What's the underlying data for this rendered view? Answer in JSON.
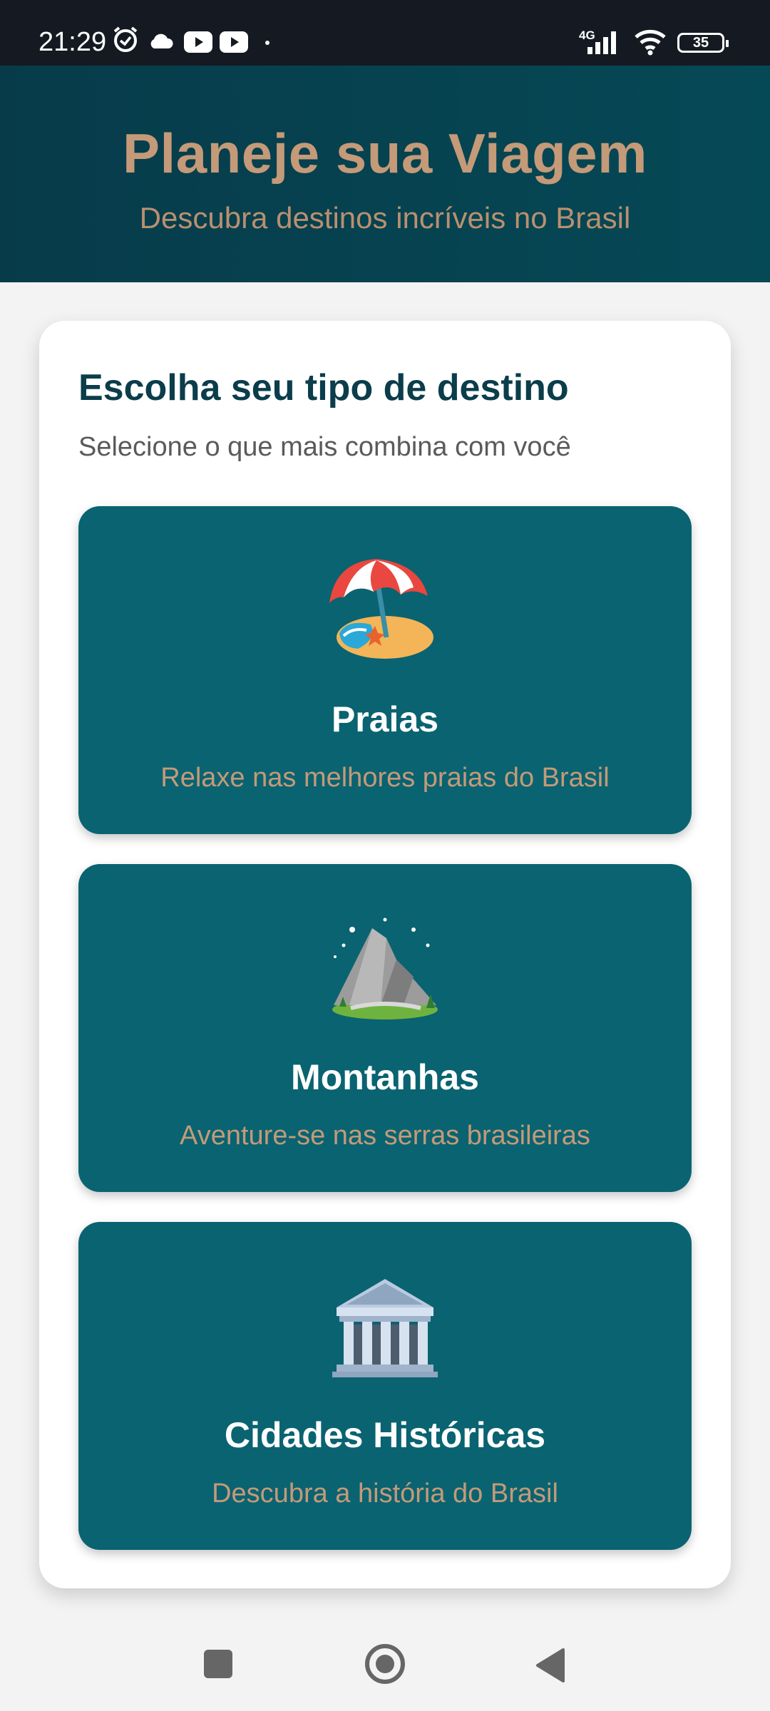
{
  "status_bar": {
    "time": "21:29",
    "network": "4G",
    "battery": "35",
    "icons": [
      "alarm-icon",
      "cloud-icon",
      "youtube-icon",
      "youtube-icon",
      "dot-icon",
      "signal-icon",
      "wifi-icon",
      "battery-icon"
    ]
  },
  "header": {
    "title": "Planeje sua Viagem",
    "subtitle": "Descubra destinos incríveis no Brasil"
  },
  "main": {
    "heading": "Escolha seu tipo de destino",
    "hint": "Selecione o que mais combina com você",
    "options": [
      {
        "icon": "beach-umbrella-icon",
        "title": "Praias",
        "description": "Relaxe nas melhores praias do Brasil"
      },
      {
        "icon": "mountain-icon",
        "title": "Montanhas",
        "description": "Aventure-se nas serras brasileiras"
      },
      {
        "icon": "classical-building-icon",
        "title": "Cidades Históricas",
        "description": "Descubra a história do Brasil"
      }
    ]
  },
  "colors": {
    "header_bg": "#064956",
    "accent_tan": "#c49a78",
    "option_bg": "#0a6371",
    "heading_text": "#0b3d4b"
  },
  "nav": [
    "recents-square-icon",
    "home-circle-icon",
    "back-triangle-icon"
  ]
}
